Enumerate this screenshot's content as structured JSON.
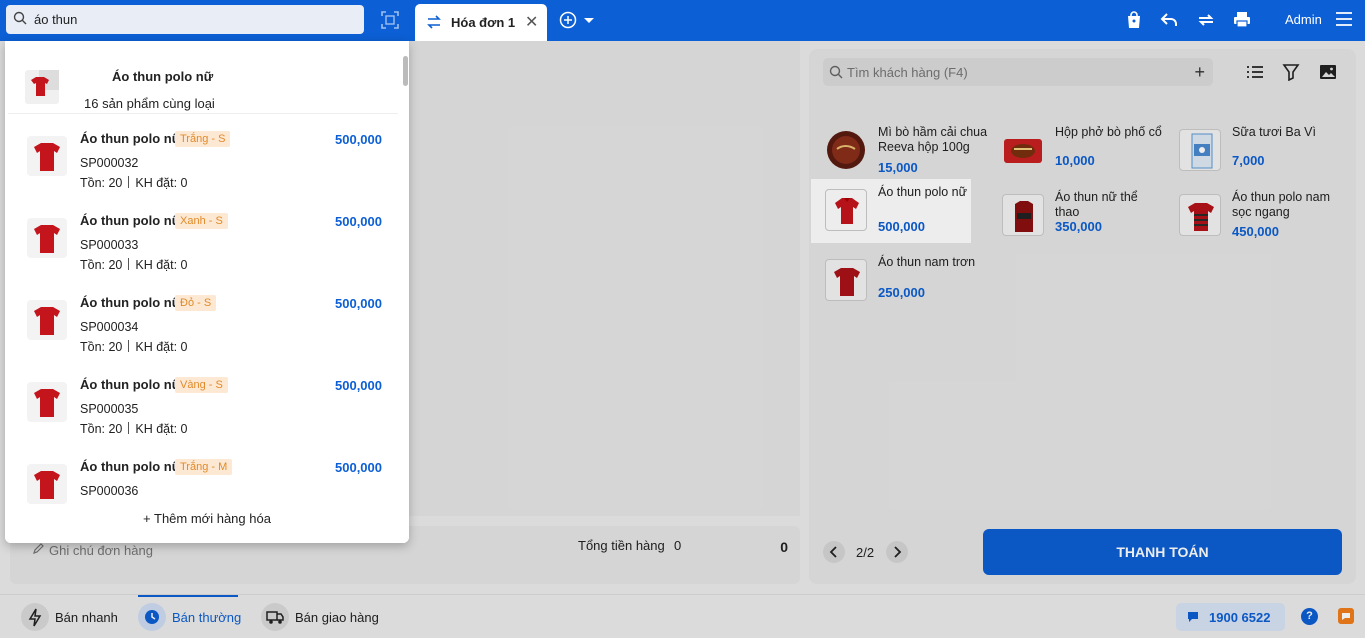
{
  "search": {
    "value": "áo thun",
    "placeholder": ""
  },
  "tab": {
    "label": "Hóa đơn 1",
    "close": "✕"
  },
  "user": {
    "name": "Admin"
  },
  "dropdown": {
    "group": {
      "title": "Áo thun polo nữ",
      "subtitle": "16 sản phẩm cùng loại"
    },
    "items": [
      {
        "name": "Áo thun polo nữ",
        "variant": "Trắng - S",
        "price": "500,000",
        "code": "SP000032",
        "stock": "Tồn: 20",
        "ordered": "KH đặt: 0"
      },
      {
        "name": "Áo thun polo nữ",
        "variant": "Xanh - S",
        "price": "500,000",
        "code": "SP000033",
        "stock": "Tồn: 20",
        "ordered": "KH đặt: 0"
      },
      {
        "name": "Áo thun polo nữ",
        "variant": "Đỏ - S",
        "price": "500,000",
        "code": "SP000034",
        "stock": "Tồn: 20",
        "ordered": "KH đặt: 0"
      },
      {
        "name": "Áo thun polo nữ",
        "variant": "Vàng - S",
        "price": "500,000",
        "code": "SP000035",
        "stock": "Tồn: 20",
        "ordered": "KH đặt: 0"
      },
      {
        "name": "Áo thun polo nữ",
        "variant": "Trắng - M",
        "price": "500,000",
        "code": "SP000036",
        "stock": "",
        "ordered": ""
      }
    ],
    "add_new": "+ Thêm mới hàng hóa"
  },
  "order": {
    "note_placeholder": "Ghi chú đơn hàng",
    "total_label": "Tổng tiền hàng",
    "total_count": "0",
    "total_amount": "0"
  },
  "customer_search": {
    "placeholder": "Tìm khách hàng (F4)"
  },
  "products": [
    {
      "name": "Mì bò hầm cải chua Reeva hộp 100g",
      "price": "15,000"
    },
    {
      "name": "Hộp phở bò phố cổ",
      "price": "10,000"
    },
    {
      "name": "Sữa tươi Ba Vì",
      "price": "7,000"
    },
    {
      "name": "Áo thun polo nữ",
      "price": "500,000"
    },
    {
      "name": "Áo thun nữ thể thao",
      "price": "350,000"
    },
    {
      "name": "Áo thun polo nam sọc ngang",
      "price": "450,000"
    },
    {
      "name": "Áo thun nam trơn",
      "price": "250,000"
    }
  ],
  "pager": {
    "text": "2/2"
  },
  "pay_button": {
    "label": "THANH TOÁN"
  },
  "modes": [
    {
      "label": "Bán nhanh",
      "icon": "bolt-icon"
    },
    {
      "label": "Bán thường",
      "icon": "clock-icon"
    },
    {
      "label": "Bán giao hàng",
      "icon": "truck-icon"
    }
  ],
  "hotline": {
    "number": "1900 6522"
  },
  "colors": {
    "brand": "#0c5fd4",
    "tag_bg": "#fde9d3",
    "tag_text": "#e08a2a",
    "shirt": "#c4141c"
  }
}
